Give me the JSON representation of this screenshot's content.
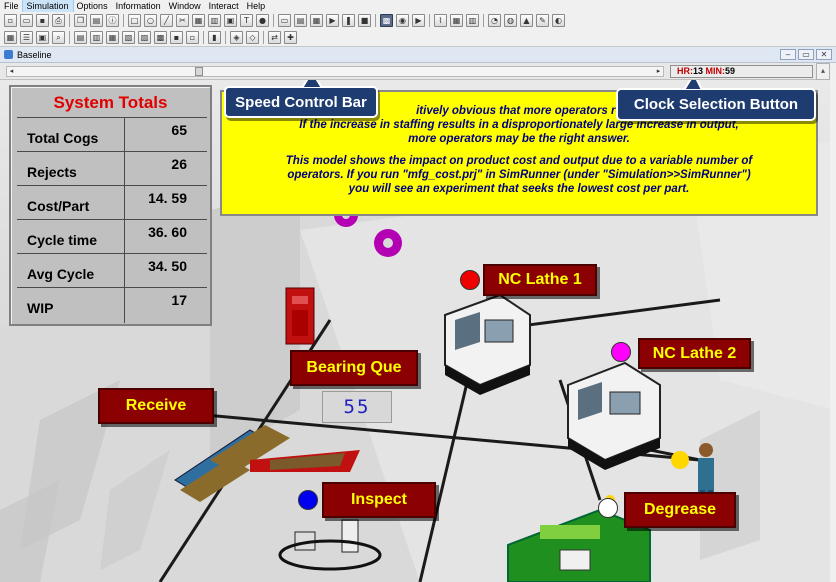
{
  "menu": [
    "File",
    "Simulation",
    "Options",
    "Information",
    "Window",
    "Interact",
    "Help"
  ],
  "menu_active": "Simulation",
  "toolbar1": [
    {
      "icon": "new-icon",
      "glyph": "▫"
    },
    {
      "icon": "open-icon",
      "glyph": "▭"
    },
    {
      "icon": "save-icon",
      "glyph": "▪"
    },
    {
      "icon": "print-icon",
      "glyph": "⎙"
    },
    {
      "icon": "sep"
    },
    {
      "icon": "copy-icon",
      "glyph": "❐"
    },
    {
      "icon": "paste-icon",
      "glyph": "▤"
    },
    {
      "icon": "info-icon",
      "glyph": "ⓘ"
    },
    {
      "icon": "sep"
    },
    {
      "icon": "rectangle-icon",
      "glyph": "□"
    },
    {
      "icon": "circle-icon",
      "glyph": "○"
    },
    {
      "icon": "line-icon",
      "glyph": "╱"
    },
    {
      "icon": "cut-icon",
      "glyph": "✂"
    },
    {
      "icon": "locations-icon",
      "glyph": "▦"
    },
    {
      "icon": "entities-icon",
      "glyph": "▥"
    },
    {
      "icon": "graphics-icon",
      "glyph": "▣"
    },
    {
      "icon": "text-icon",
      "glyph": "T"
    },
    {
      "icon": "about-icon",
      "glyph": "●"
    },
    {
      "icon": "sep"
    },
    {
      "icon": "window-icon",
      "glyph": "▭"
    },
    {
      "icon": "tile-icon",
      "glyph": "▤"
    },
    {
      "icon": "cascade-icon",
      "glyph": "▦"
    },
    {
      "icon": "run-icon",
      "glyph": "▶"
    },
    {
      "icon": "pause-icon",
      "glyph": "❚"
    },
    {
      "icon": "stop-icon",
      "glyph": "■"
    },
    {
      "icon": "sep"
    },
    {
      "icon": "display-icon",
      "glyph": "▩",
      "selected": true
    },
    {
      "icon": "animation-icon",
      "glyph": "◉"
    },
    {
      "icon": "screen-icon",
      "glyph": "▶"
    },
    {
      "icon": "sep"
    },
    {
      "icon": "chart-icon",
      "glyph": "⌇"
    },
    {
      "icon": "output-icon",
      "glyph": "▦"
    },
    {
      "icon": "statistics-icon",
      "glyph": "▥"
    },
    {
      "icon": "sep"
    },
    {
      "icon": "resource-icon",
      "glyph": "◔"
    },
    {
      "icon": "globe-icon",
      "glyph": "◍"
    },
    {
      "icon": "triangle-icon",
      "glyph": "▲"
    },
    {
      "icon": "tools-icon",
      "glyph": "✎"
    },
    {
      "icon": "dashboard-icon",
      "glyph": "◐"
    }
  ],
  "toolbar2": [
    {
      "icon": "grid-icon",
      "glyph": "▦"
    },
    {
      "icon": "list-icon",
      "glyph": "☰"
    },
    {
      "icon": "view-icon",
      "glyph": "▣"
    },
    {
      "icon": "zoom-icon",
      "glyph": "⌕"
    },
    {
      "icon": "sep"
    },
    {
      "icon": "align-1-icon",
      "glyph": "▤"
    },
    {
      "icon": "align-2-icon",
      "glyph": "▥"
    },
    {
      "icon": "align-3-icon",
      "glyph": "▦"
    },
    {
      "icon": "align-4-icon",
      "glyph": "▧"
    },
    {
      "icon": "align-5-icon",
      "glyph": "▨"
    },
    {
      "icon": "align-6-icon",
      "glyph": "▩"
    },
    {
      "icon": "align-7-icon",
      "glyph": "▪"
    },
    {
      "icon": "align-8-icon",
      "glyph": "▫"
    },
    {
      "icon": "sep"
    },
    {
      "icon": "lock-icon",
      "glyph": "▮"
    },
    {
      "icon": "sep"
    },
    {
      "icon": "group-icon",
      "glyph": "◈"
    },
    {
      "icon": "ungroup-icon",
      "glyph": "◇"
    },
    {
      "icon": "sep"
    },
    {
      "icon": "route-icon",
      "glyph": "⇄"
    },
    {
      "icon": "pin-icon",
      "glyph": "✚"
    }
  ],
  "window": {
    "title": "Baseline",
    "buttons": [
      "‒",
      "▭",
      "✕"
    ]
  },
  "clock": {
    "hr_label": "HR:",
    "hr_value": "13",
    "min_label": "MIN:",
    "min_value": "59"
  },
  "speed": {
    "thumb_fraction": 0.29
  },
  "callouts": {
    "speed": "Speed Control Bar",
    "clock": "Clock Selection Button"
  },
  "totals": {
    "title": "System Totals",
    "rows": [
      {
        "label": "Total Cogs",
        "value": "65"
      },
      {
        "label": "Rejects",
        "value": "26"
      },
      {
        "label": "Cost/Part",
        "value": "14. 59"
      },
      {
        "label": "Cycle time",
        "value": "36. 60"
      },
      {
        "label": "Avg Cycle",
        "value": "34. 50"
      },
      {
        "label": "WIP",
        "value": "17"
      }
    ]
  },
  "note": {
    "line1": "itively obvious that more operators re",
    "line2": "If the increase in staffing results in a disproportionately large increase in output,",
    "line3": "more operators may be the right answer.",
    "line4": "This model shows the impact on product cost and output due to a variable number of",
    "line5": "operators.  If you run \"mfg_cost.prj\" in SimRunner (under \"Simulation>>SimRunner\")",
    "line6": "you will see an experiment that seeks the lowest cost per part."
  },
  "labels": {
    "nc_lathe_1": "NC Lathe 1",
    "nc_lathe_2": "NC Lathe 2",
    "bearing_que": "Bearing Que",
    "receive": "Receive",
    "inspect": "Inspect",
    "degrease": "Degrease"
  },
  "bearing_counter": "55",
  "colors": {
    "label_bg": "#8b0000",
    "label_text": "#ffff00",
    "callout_bg": "#1e3c70",
    "note_bg": "#ffff00",
    "status_red": "#ee0000",
    "status_magenta": "#ff00ff",
    "status_blue": "#0000ee",
    "status_white": "#ffffff"
  }
}
